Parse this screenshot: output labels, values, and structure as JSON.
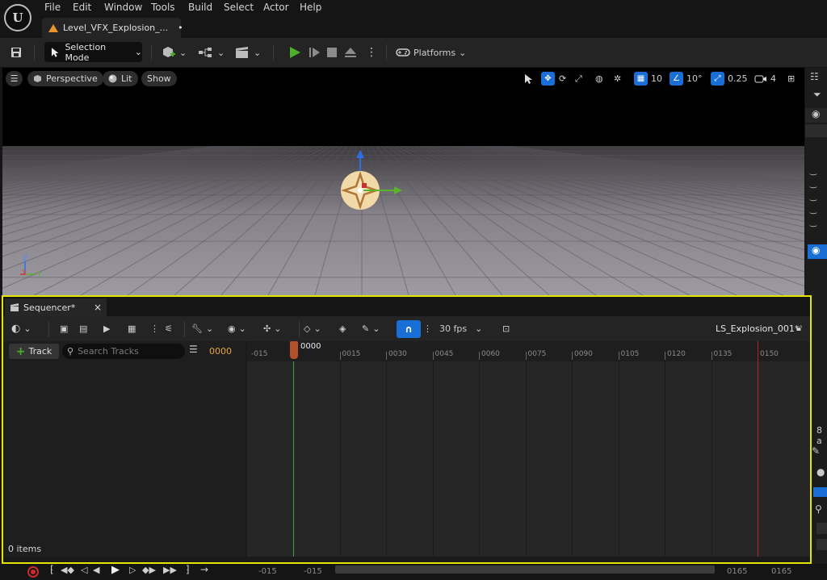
{
  "menu": {
    "items": [
      "File",
      "Edit",
      "Window",
      "Tools",
      "Build",
      "Select",
      "Actor",
      "Help"
    ]
  },
  "document_tab": {
    "title": "Level_VFX_Explosion_...",
    "modified_marker": "•"
  },
  "toolbar": {
    "selection_mode": "Selection Mode",
    "platforms": "Platforms"
  },
  "viewport": {
    "perspective": "Perspective",
    "lit": "Lit",
    "show": "Show",
    "grid_snap": "10",
    "rotation_snap": "10°",
    "scale_snap": "0.25",
    "camera_speed": "4",
    "axis_labels": {
      "z": "Z",
      "x": "X",
      "y": "Y"
    }
  },
  "sequencer": {
    "tab_title": "Sequencer*",
    "track_button": "Track",
    "search_placeholder": "Search Tracks",
    "current_frame": "0000",
    "fps": "30 fps",
    "sequence_name": "LS_Explosion_001*",
    "items_count": "0 items",
    "playhead_label": "0000",
    "ruler_ticks": [
      "-015",
      "0015",
      "0030",
      "0045",
      "0060",
      "0075",
      "0090",
      "0105",
      "0120",
      "0135",
      "0150"
    ],
    "range_start": "-015",
    "view_start": "-015",
    "view_end": "0165",
    "range_end": "0165"
  },
  "right_panel": {
    "count_fragment": "8 a"
  },
  "colors": {
    "accent_blue": "#1a6fd6",
    "highlight_yellow": "#e5e500",
    "frame_orange": "#e8a33a",
    "play_green": "#4caf28"
  }
}
